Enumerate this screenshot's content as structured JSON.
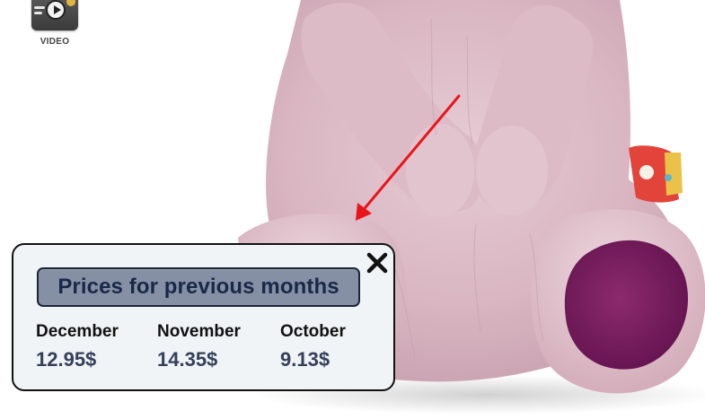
{
  "video": {
    "label": "VIDEO",
    "icon": "video-play-icon"
  },
  "product": {
    "subject": "plush teddy bear",
    "colors": {
      "fur": "#d8b3c0",
      "paw_pad": "#7a1d5d",
      "tag": "#e2443a"
    }
  },
  "annotation": {
    "arrow_color": "#e8161b"
  },
  "popup": {
    "title": "Prices for previous months",
    "close_icon": "close-icon",
    "months": [
      {
        "name": "December",
        "price": "12.95$"
      },
      {
        "name": "November",
        "price": "14.35$"
      },
      {
        "name": "October",
        "price": "9.13$"
      }
    ],
    "colors": {
      "background": "#f0f4f7",
      "title_background": "#8590a4",
      "title_text": "#1a2848",
      "price_text": "#34405a"
    }
  }
}
